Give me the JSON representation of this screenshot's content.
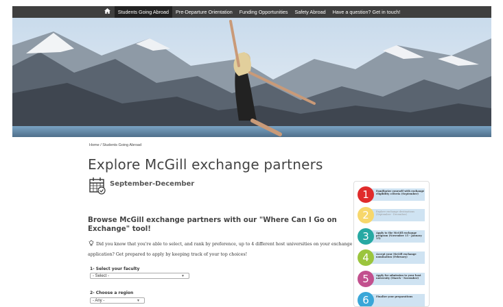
{
  "nav": {
    "home_icon": "home-icon",
    "items": [
      {
        "label": "Students Going Abroad",
        "active": true
      },
      {
        "label": "Pre-Departure Orientation",
        "active": false
      },
      {
        "label": "Funding Opportunities",
        "active": false
      },
      {
        "label": "Safety Abroad",
        "active": false
      },
      {
        "label": "Have a question? Get in touch!",
        "active": false
      }
    ]
  },
  "breadcrumb": {
    "home": "Home",
    "separator": " / ",
    "current": "Students Going Abroad"
  },
  "page": {
    "title": "Explore McGill exchange partners",
    "calendar_icon": "calendar-check-icon",
    "period": "September-December",
    "browse_heading": "Browse McGill exchange partners with our \"Where Can I Go on Exchange\" tool!",
    "tip_icon": "lightbulb-icon",
    "tip_text": "Did you know that you're able to select, and rank by preference, up to 4 different host universities on your exchange application? Get prepared to apply by keeping track of your top choices!"
  },
  "form": {
    "faculty_label": "1- Select your faculty",
    "faculty_value": "- Select -",
    "region_label": "2- Choose a region",
    "region_value": "- Any -"
  },
  "steps": [
    {
      "number": "1",
      "color": "#e02b2b",
      "text": "Familiarize yourself with exchange eligibility criteria (September)",
      "faded": false
    },
    {
      "number": "2",
      "color": "#f7d76b",
      "text": "Explore exchange destinations (September - December)",
      "faded": true
    },
    {
      "number": "3",
      "color": "#27a9a3",
      "text": "Apply to the McGill exchange program (November 15 - January 15)",
      "faded": false
    },
    {
      "number": "4",
      "color": "#9bc53d",
      "text": "Accept your McGill exchange nomination (February)",
      "faded": false
    },
    {
      "number": "5",
      "color": "#c2508e",
      "text": "Apply for admission to your host university (March - November)",
      "faded": false
    },
    {
      "number": "6",
      "color": "#3aa7d8",
      "text": "Finalize your preparations",
      "faded": false
    }
  ],
  "colors": {
    "nav_bg": "#3f3f3f",
    "nav_active": "#222222",
    "step_box": "#cfe3f2"
  }
}
